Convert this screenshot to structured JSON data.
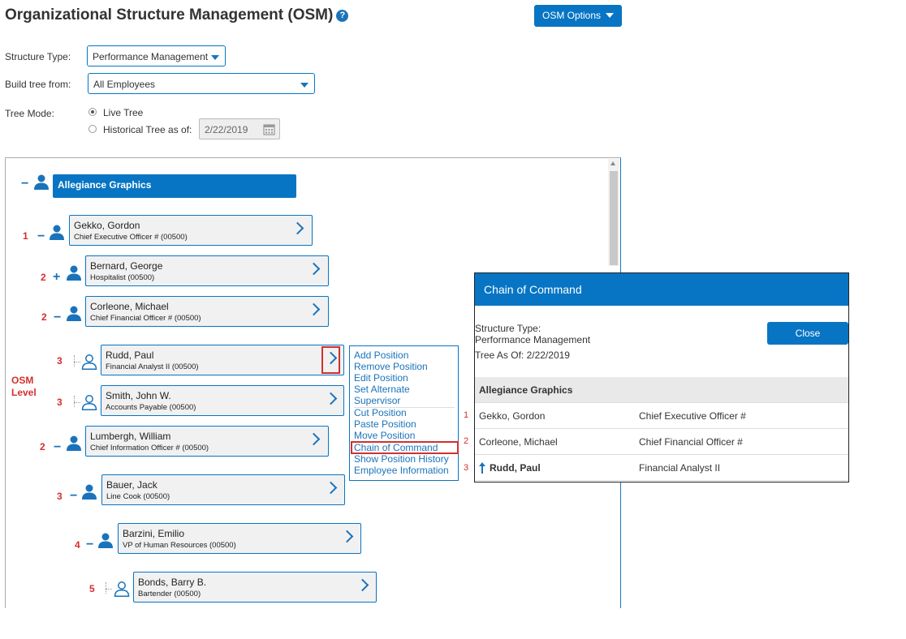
{
  "header": {
    "title": "Organizational Structure Management (OSM)",
    "help_icon": "question-circle-icon",
    "options_label": "OSM Options"
  },
  "form": {
    "structure_type_label": "Structure Type:",
    "structure_type_value": "Performance Management",
    "build_tree_label": "Build tree from:",
    "build_tree_value": "All Employees",
    "tree_mode_label": "Tree Mode:",
    "live_tree_label": "Live Tree",
    "historical_label": "Historical Tree as of:",
    "historical_date": "2/22/2019",
    "live_selected": true
  },
  "tree": {
    "root": "Allegiance Graphics",
    "osm_level_label": "OSM Level",
    "nodes": [
      {
        "level": "1",
        "toggle": "−",
        "name": "Gekko, Gordon",
        "position": "Chief Executive Officer # (00500)"
      },
      {
        "level": "2",
        "toggle": "+",
        "name": "Bernard, George",
        "position": "Hospitalist (00500)"
      },
      {
        "level": "2",
        "toggle": "−",
        "name": "Corleone, Michael",
        "position": "Chief Financial Officer # (00500)"
      },
      {
        "level": "3",
        "toggle": "",
        "name": "Rudd, Paul",
        "position": "Financial Analyst II (00500)"
      },
      {
        "level": "3",
        "toggle": "",
        "name": "Smith, John W.",
        "position": "Accounts Payable (00500)"
      },
      {
        "level": "2",
        "toggle": "−",
        "name": "Lumbergh, William",
        "position": "Chief Information Officer # (00500)"
      },
      {
        "level": "3",
        "toggle": "−",
        "name": "Bauer, Jack",
        "position": "Line Cook (00500)"
      },
      {
        "level": "4",
        "toggle": "−",
        "name": "Barzini, Emilio",
        "position": "VP of Human Resources (00500)"
      },
      {
        "level": "5",
        "toggle": "",
        "name": "Bonds, Barry B.",
        "position": "Bartender (00500)"
      }
    ]
  },
  "context_menu": {
    "items": [
      "Add Position",
      "Remove Position",
      "Edit Position",
      "Set Alternate",
      "Supervisor",
      "Cut Position",
      "Paste Position",
      "Move Position",
      "Chain of Command",
      "Show Position History",
      "Employee Information"
    ],
    "highlighted": "Chain of Command"
  },
  "chain_of_command": {
    "title": "Chain of Command",
    "structure_type_label": "Structure Type:",
    "structure_type_value": "Performance Management",
    "tree_as_of": "Tree As Of: 2/22/2019",
    "close_label": "Close",
    "group": "Allegiance Graphics",
    "rows": [
      {
        "num": "1",
        "name": "Gekko, Gordon",
        "position": "Chief Executive Officer #"
      },
      {
        "num": "2",
        "name": "Corleone, Michael",
        "position": "Chief Financial Officer #"
      },
      {
        "num": "3",
        "name": "Rudd, Paul",
        "position": "Financial Analyst II"
      }
    ]
  },
  "colors": {
    "primary": "#0775c4",
    "annotation_red": "#d62f2f"
  }
}
